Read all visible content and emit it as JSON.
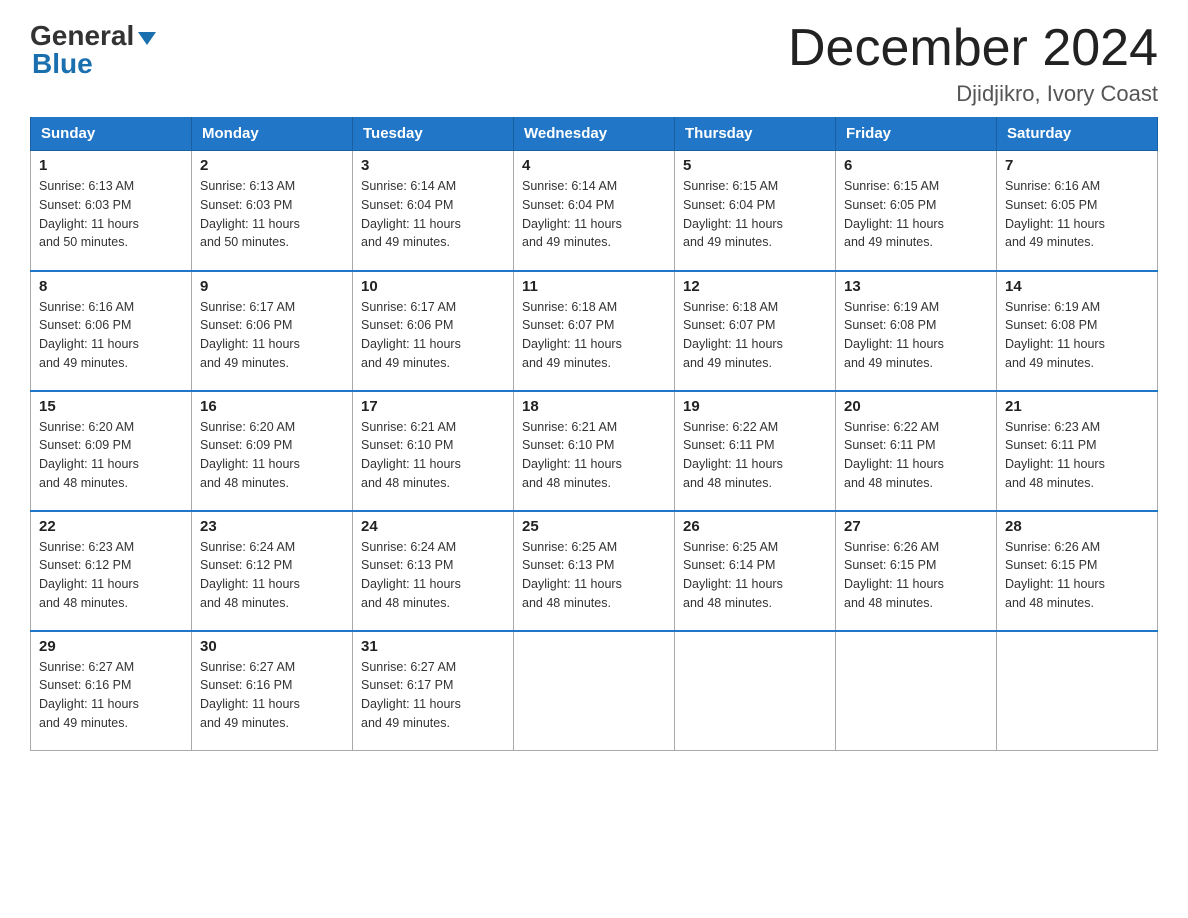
{
  "logo": {
    "general": "General",
    "blue": "Blue"
  },
  "title": "December 2024",
  "location": "Djidjikro, Ivory Coast",
  "days_of_week": [
    "Sunday",
    "Monday",
    "Tuesday",
    "Wednesday",
    "Thursday",
    "Friday",
    "Saturday"
  ],
  "weeks": [
    [
      {
        "day": "1",
        "sunrise": "6:13 AM",
        "sunset": "6:03 PM",
        "daylight": "11 hours and 50 minutes."
      },
      {
        "day": "2",
        "sunrise": "6:13 AM",
        "sunset": "6:03 PM",
        "daylight": "11 hours and 50 minutes."
      },
      {
        "day": "3",
        "sunrise": "6:14 AM",
        "sunset": "6:04 PM",
        "daylight": "11 hours and 49 minutes."
      },
      {
        "day": "4",
        "sunrise": "6:14 AM",
        "sunset": "6:04 PM",
        "daylight": "11 hours and 49 minutes."
      },
      {
        "day": "5",
        "sunrise": "6:15 AM",
        "sunset": "6:04 PM",
        "daylight": "11 hours and 49 minutes."
      },
      {
        "day": "6",
        "sunrise": "6:15 AM",
        "sunset": "6:05 PM",
        "daylight": "11 hours and 49 minutes."
      },
      {
        "day": "7",
        "sunrise": "6:16 AM",
        "sunset": "6:05 PM",
        "daylight": "11 hours and 49 minutes."
      }
    ],
    [
      {
        "day": "8",
        "sunrise": "6:16 AM",
        "sunset": "6:06 PM",
        "daylight": "11 hours and 49 minutes."
      },
      {
        "day": "9",
        "sunrise": "6:17 AM",
        "sunset": "6:06 PM",
        "daylight": "11 hours and 49 minutes."
      },
      {
        "day": "10",
        "sunrise": "6:17 AM",
        "sunset": "6:06 PM",
        "daylight": "11 hours and 49 minutes."
      },
      {
        "day": "11",
        "sunrise": "6:18 AM",
        "sunset": "6:07 PM",
        "daylight": "11 hours and 49 minutes."
      },
      {
        "day": "12",
        "sunrise": "6:18 AM",
        "sunset": "6:07 PM",
        "daylight": "11 hours and 49 minutes."
      },
      {
        "day": "13",
        "sunrise": "6:19 AM",
        "sunset": "6:08 PM",
        "daylight": "11 hours and 49 minutes."
      },
      {
        "day": "14",
        "sunrise": "6:19 AM",
        "sunset": "6:08 PM",
        "daylight": "11 hours and 49 minutes."
      }
    ],
    [
      {
        "day": "15",
        "sunrise": "6:20 AM",
        "sunset": "6:09 PM",
        "daylight": "11 hours and 48 minutes."
      },
      {
        "day": "16",
        "sunrise": "6:20 AM",
        "sunset": "6:09 PM",
        "daylight": "11 hours and 48 minutes."
      },
      {
        "day": "17",
        "sunrise": "6:21 AM",
        "sunset": "6:10 PM",
        "daylight": "11 hours and 48 minutes."
      },
      {
        "day": "18",
        "sunrise": "6:21 AM",
        "sunset": "6:10 PM",
        "daylight": "11 hours and 48 minutes."
      },
      {
        "day": "19",
        "sunrise": "6:22 AM",
        "sunset": "6:11 PM",
        "daylight": "11 hours and 48 minutes."
      },
      {
        "day": "20",
        "sunrise": "6:22 AM",
        "sunset": "6:11 PM",
        "daylight": "11 hours and 48 minutes."
      },
      {
        "day": "21",
        "sunrise": "6:23 AM",
        "sunset": "6:11 PM",
        "daylight": "11 hours and 48 minutes."
      }
    ],
    [
      {
        "day": "22",
        "sunrise": "6:23 AM",
        "sunset": "6:12 PM",
        "daylight": "11 hours and 48 minutes."
      },
      {
        "day": "23",
        "sunrise": "6:24 AM",
        "sunset": "6:12 PM",
        "daylight": "11 hours and 48 minutes."
      },
      {
        "day": "24",
        "sunrise": "6:24 AM",
        "sunset": "6:13 PM",
        "daylight": "11 hours and 48 minutes."
      },
      {
        "day": "25",
        "sunrise": "6:25 AM",
        "sunset": "6:13 PM",
        "daylight": "11 hours and 48 minutes."
      },
      {
        "day": "26",
        "sunrise": "6:25 AM",
        "sunset": "6:14 PM",
        "daylight": "11 hours and 48 minutes."
      },
      {
        "day": "27",
        "sunrise": "6:26 AM",
        "sunset": "6:15 PM",
        "daylight": "11 hours and 48 minutes."
      },
      {
        "day": "28",
        "sunrise": "6:26 AM",
        "sunset": "6:15 PM",
        "daylight": "11 hours and 48 minutes."
      }
    ],
    [
      {
        "day": "29",
        "sunrise": "6:27 AM",
        "sunset": "6:16 PM",
        "daylight": "11 hours and 49 minutes."
      },
      {
        "day": "30",
        "sunrise": "6:27 AM",
        "sunset": "6:16 PM",
        "daylight": "11 hours and 49 minutes."
      },
      {
        "day": "31",
        "sunrise": "6:27 AM",
        "sunset": "6:17 PM",
        "daylight": "11 hours and 49 minutes."
      },
      null,
      null,
      null,
      null
    ]
  ],
  "labels": {
    "sunrise": "Sunrise:",
    "sunset": "Sunset:",
    "daylight": "Daylight:"
  }
}
